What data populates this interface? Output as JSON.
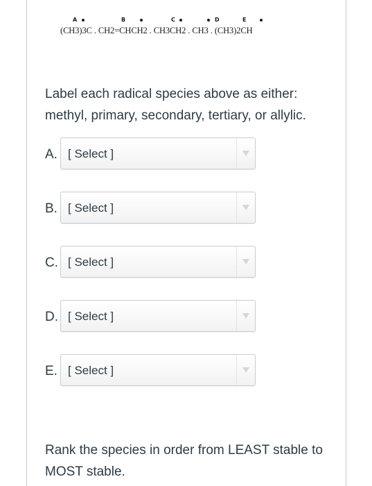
{
  "formula": {
    "text": "(CH3)3C . CH2=CHCH2 . CH3CH2 . CH3 . (CH3)2CH",
    "labels": [
      "A",
      "B",
      "C",
      "D",
      "E"
    ]
  },
  "question": {
    "prompt": "Label each radical species above as either: methyl, primary, secondary, tertiary, or allylic."
  },
  "answers": [
    {
      "letter": "A.",
      "value": "[ Select ]"
    },
    {
      "letter": "B.",
      "value": "[ Select ]"
    },
    {
      "letter": "C.",
      "value": "[ Select ]"
    },
    {
      "letter": "D.",
      "value": "[ Select ]"
    },
    {
      "letter": "E.",
      "value": "[ Select ]"
    }
  ],
  "rank": {
    "prompt": "Rank the species in order from LEAST stable to MOST stable."
  },
  "colors": {
    "text": "#2d3b45",
    "border": "#c7cdd1"
  }
}
